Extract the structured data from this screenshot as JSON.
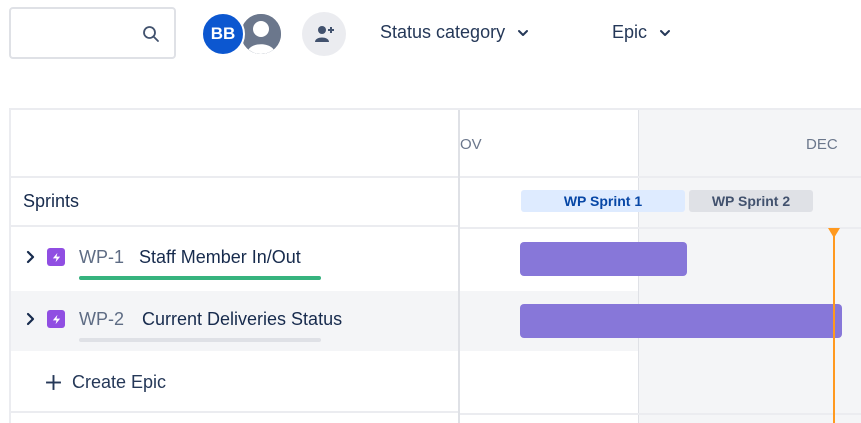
{
  "toolbar": {
    "search": {
      "value": "",
      "placeholder": ""
    },
    "avatars": [
      {
        "initials": "BB"
      },
      {
        "icon": "user-icon"
      }
    ],
    "add_people_icon": "add-user-icon",
    "filters": [
      {
        "label": "Status category",
        "icon": "chevron-down-icon"
      },
      {
        "label": "Epic",
        "icon": "chevron-down-icon"
      }
    ]
  },
  "timeline": {
    "months": [
      "OV",
      "DEC"
    ],
    "sprints_label": "Sprints",
    "sprints": [
      {
        "label": "WP Sprint 1",
        "color": "#deebff",
        "text_color": "#0747a6"
      },
      {
        "label": "WP Sprint 2",
        "color": "#dfe1e6",
        "text_color": "#42526e"
      }
    ],
    "epics": [
      {
        "key": "WP-1",
        "title": "Staff Member In/Out",
        "progress": 1.0,
        "progress_color": "#36b37e"
      },
      {
        "key": "WP-2",
        "title": "Current Deliveries Status",
        "progress": 0.0,
        "progress_color": "#dfe1e6"
      }
    ],
    "create_label": "Create Epic",
    "bar_color": "#8777d9",
    "today_color": "#ff991f"
  }
}
